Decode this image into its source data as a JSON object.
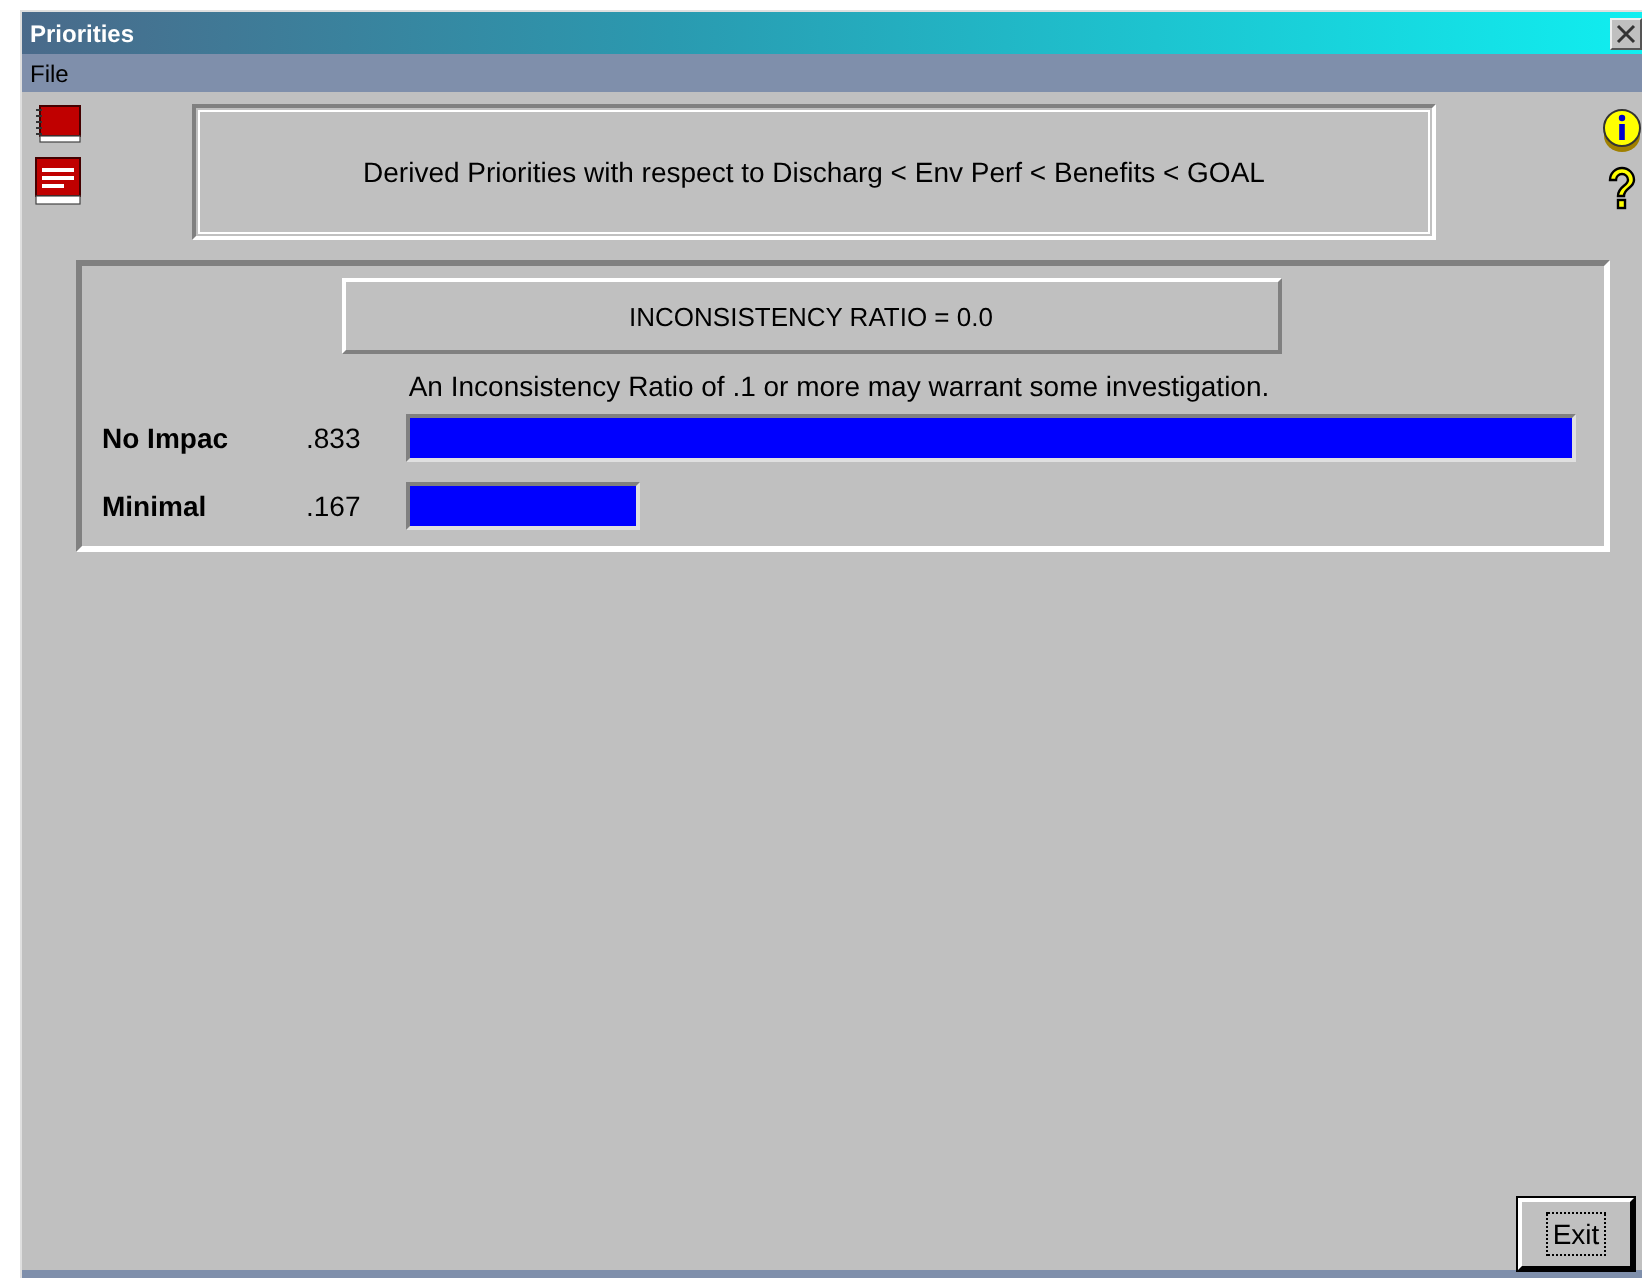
{
  "window": {
    "title": "Priorities"
  },
  "menu": [
    "File"
  ],
  "heading": "Derived Priorities with respect to Discharg < Env Perf < Benefits < GOAL",
  "inconsistency": {
    "ratio": "INCONSISTENCY RATIO = 0.0",
    "note": "An Inconsistency Ratio of .1 or more may warrant some investigation."
  },
  "priorities": [
    {
      "name": "No Impac",
      "value": ".833"
    },
    {
      "name": "Minimal",
      "value": ".167"
    }
  ],
  "buttons": [
    "Exit"
  ]
}
